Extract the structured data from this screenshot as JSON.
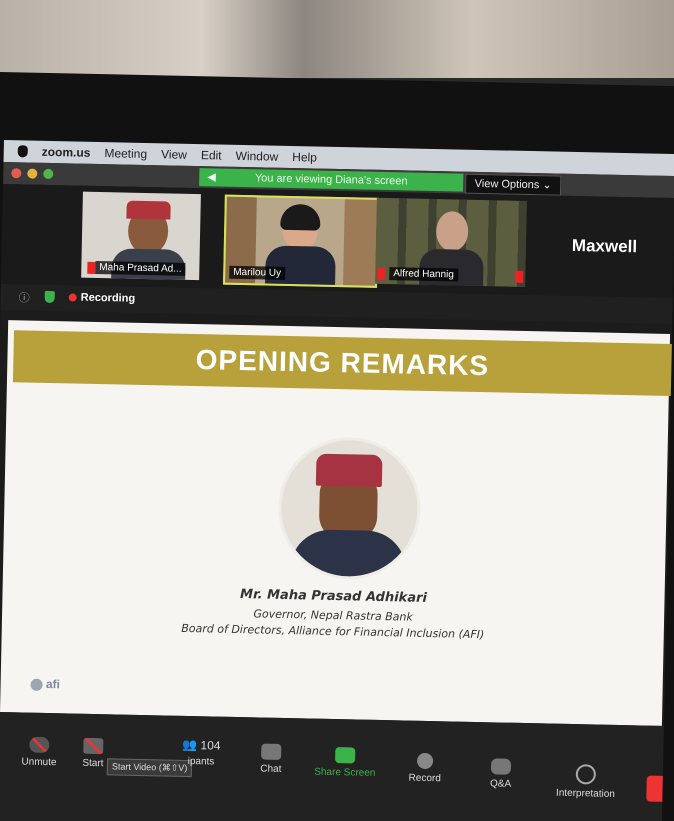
{
  "menubar": {
    "items": [
      "zoom.us",
      "Meeting",
      "View",
      "Edit",
      "Window",
      "Help"
    ]
  },
  "titlebar": {
    "viewing_banner": "You are viewing Diana's screen",
    "view_options": "View Options"
  },
  "participants": [
    {
      "name": "Maha Prasad Ad..."
    },
    {
      "name": "Marilou Uy"
    },
    {
      "name": "Alfred Hannig"
    },
    {
      "name": "Maxwell"
    }
  ],
  "status": {
    "recording": "Recording"
  },
  "slide": {
    "title": "OPENING REMARKS",
    "speaker_name": "Mr. Maha Prasad Adhikari",
    "speaker_role": "Governor, Nepal Rastra Bank",
    "speaker_org": "Board of Directors, Alliance for Financial Inclusion (AFI)",
    "logo": "afi"
  },
  "toolbar": {
    "unmute": "Unmute",
    "start_video": "Start",
    "tooltip": "Start Video (⌘⇧V)",
    "participants_count": "104",
    "participants_label": "ipants",
    "chat": "Chat",
    "share_screen": "Share Screen",
    "record": "Record",
    "qa": "Q&A",
    "interpretation": "Interpretation"
  },
  "colors": {
    "banner": "#b8a03a",
    "share_green": "#3cb24a",
    "record_red": "#e33333"
  }
}
